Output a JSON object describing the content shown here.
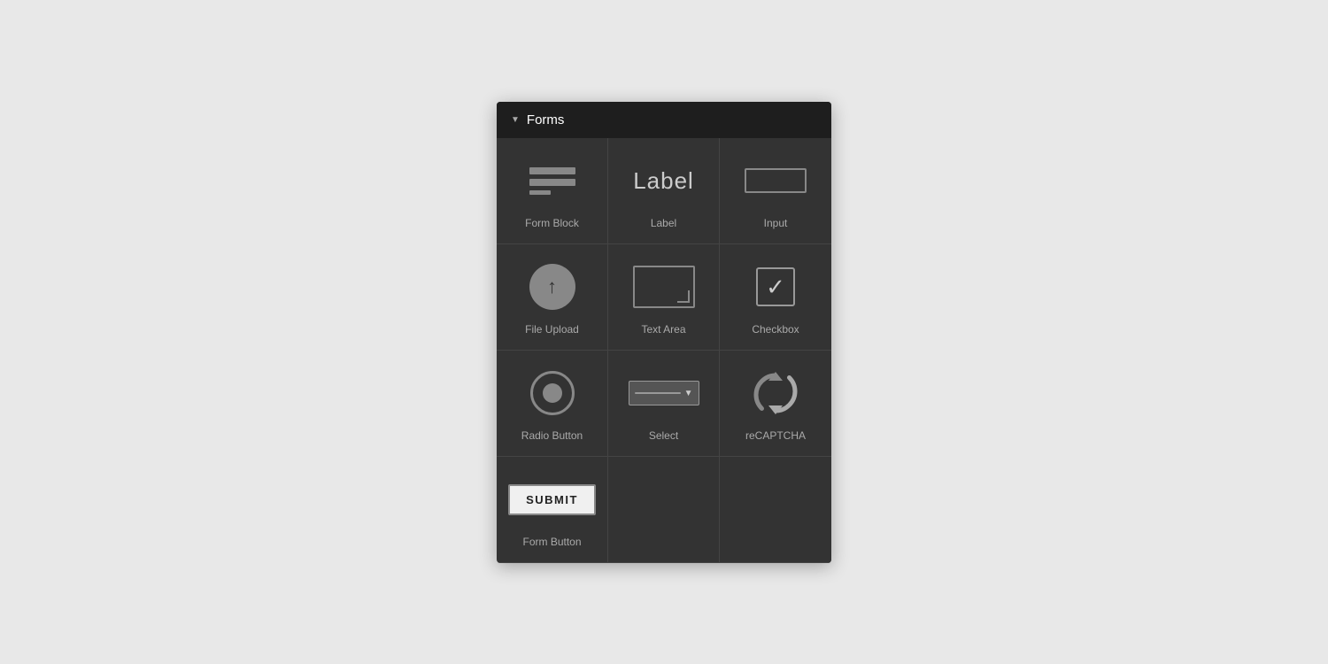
{
  "panel": {
    "header": {
      "title": "Forms",
      "chevron": "▼"
    },
    "cells": [
      {
        "id": "form-block",
        "label": "Form Block"
      },
      {
        "id": "label",
        "label": "Label"
      },
      {
        "id": "input",
        "label": "Input"
      },
      {
        "id": "file-upload",
        "label": "File Upload"
      },
      {
        "id": "text-area",
        "label": "Text Area"
      },
      {
        "id": "checkbox",
        "label": "Checkbox"
      },
      {
        "id": "radio-button",
        "label": "Radio Button"
      },
      {
        "id": "select",
        "label": "Select"
      },
      {
        "id": "recaptcha",
        "label": "reCAPTCHA"
      },
      {
        "id": "form-button",
        "label": "Form Button"
      }
    ],
    "submit_label": "SUBMIT"
  }
}
